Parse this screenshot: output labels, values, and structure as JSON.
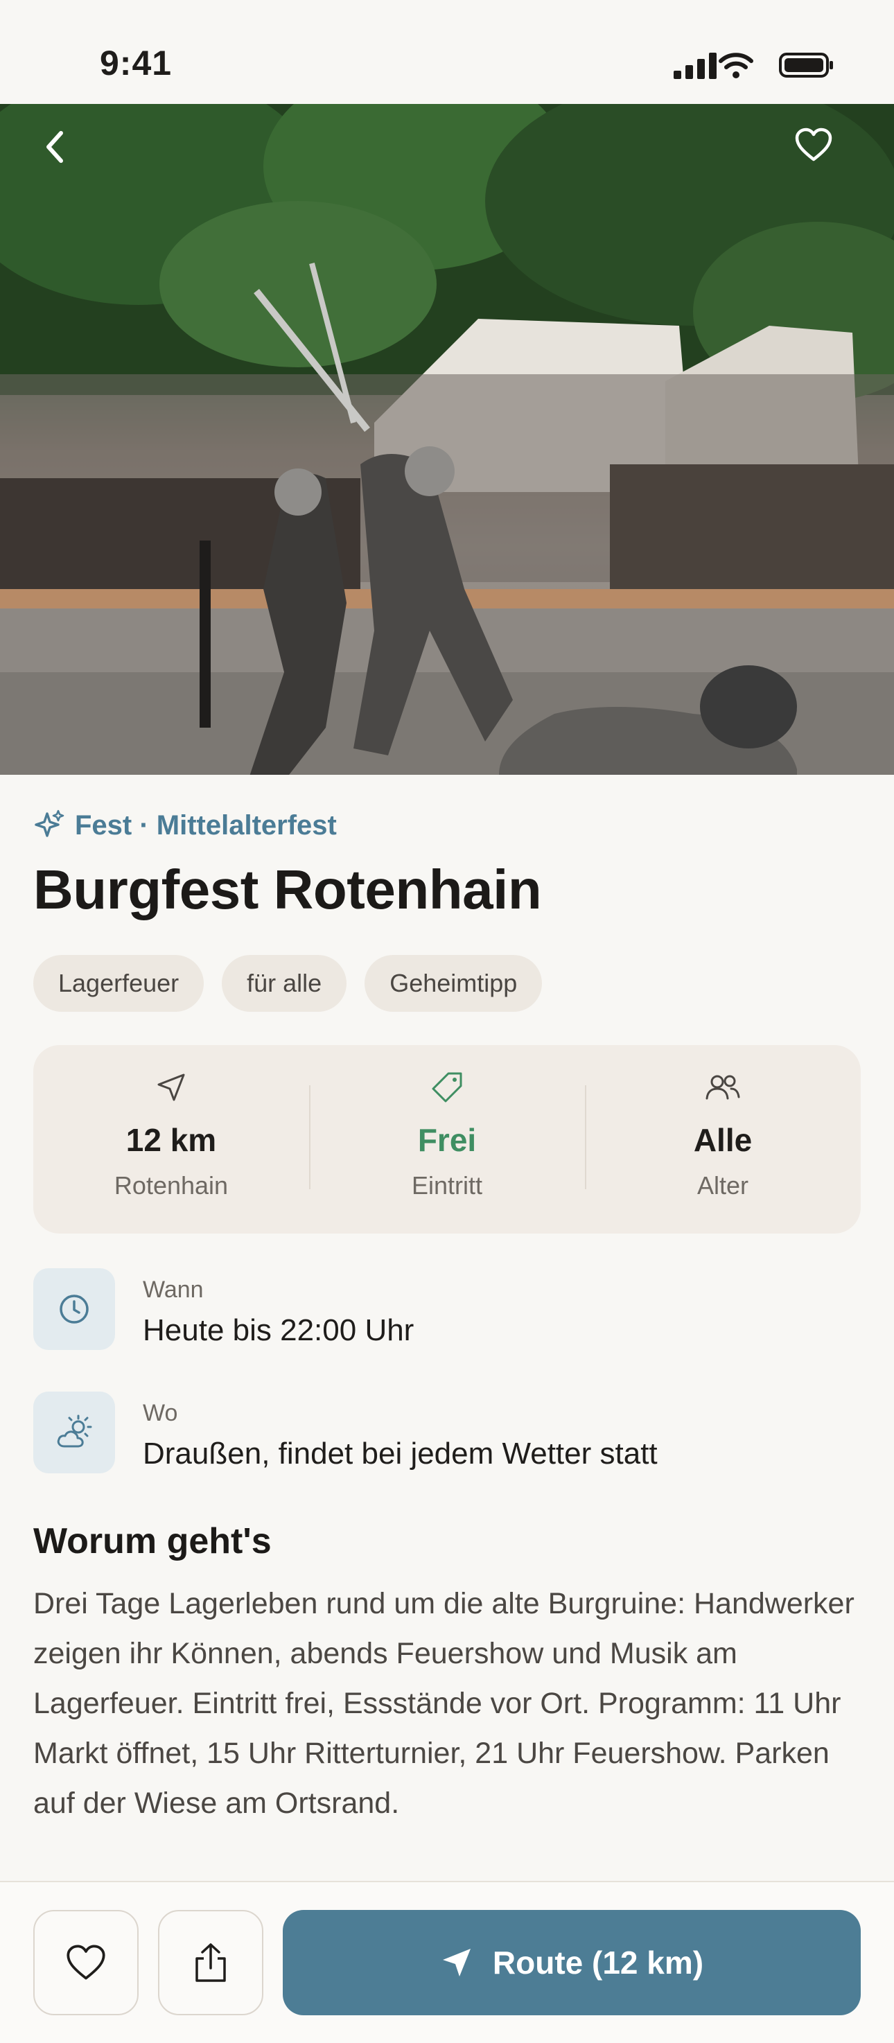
{
  "status_bar": {
    "time": "9:41"
  },
  "hero": {
    "image": "medieval-knights-sword-fight-photo"
  },
  "event": {
    "category": "Fest · Mittelalterfest",
    "title": "Burgfest Rotenhain",
    "tags": [
      "Lagerfeuer",
      "für alle",
      "Geheimtipp"
    ]
  },
  "stats": [
    {
      "icon": "navigation-arrow-icon",
      "value": "12 km",
      "label": "Rotenhain"
    },
    {
      "icon": "price-tag-icon",
      "value": "Frei",
      "label": "Eintritt"
    },
    {
      "icon": "people-icon",
      "value": "Alle",
      "label": "Alter"
    }
  ],
  "info": {
    "when": {
      "label": "Wann",
      "value": "Heute bis 22:00 Uhr"
    },
    "where": {
      "label": "Wo",
      "value": "Draußen, findet bei jedem Wetter statt"
    }
  },
  "about": {
    "title": "Worum geht's",
    "text": "Drei Tage Lagerleben rund um die alte Burgruine: Handwerker zeigen ihr Können, abends Feuershow und Musik am Lagerfeuer. Eintritt frei, Essstände vor Ort. Programm: 11 Uhr Markt öffnet, 15 Uhr Ritterturnier, 21 Uhr Feuershow. Parken auf der Wiese am Ortsrand."
  },
  "actions": {
    "route_label": "Route (12 km)"
  },
  "colors": {
    "accent": "#4d7d95",
    "free_green": "#3f8e62",
    "background": "#f8f7f4"
  }
}
